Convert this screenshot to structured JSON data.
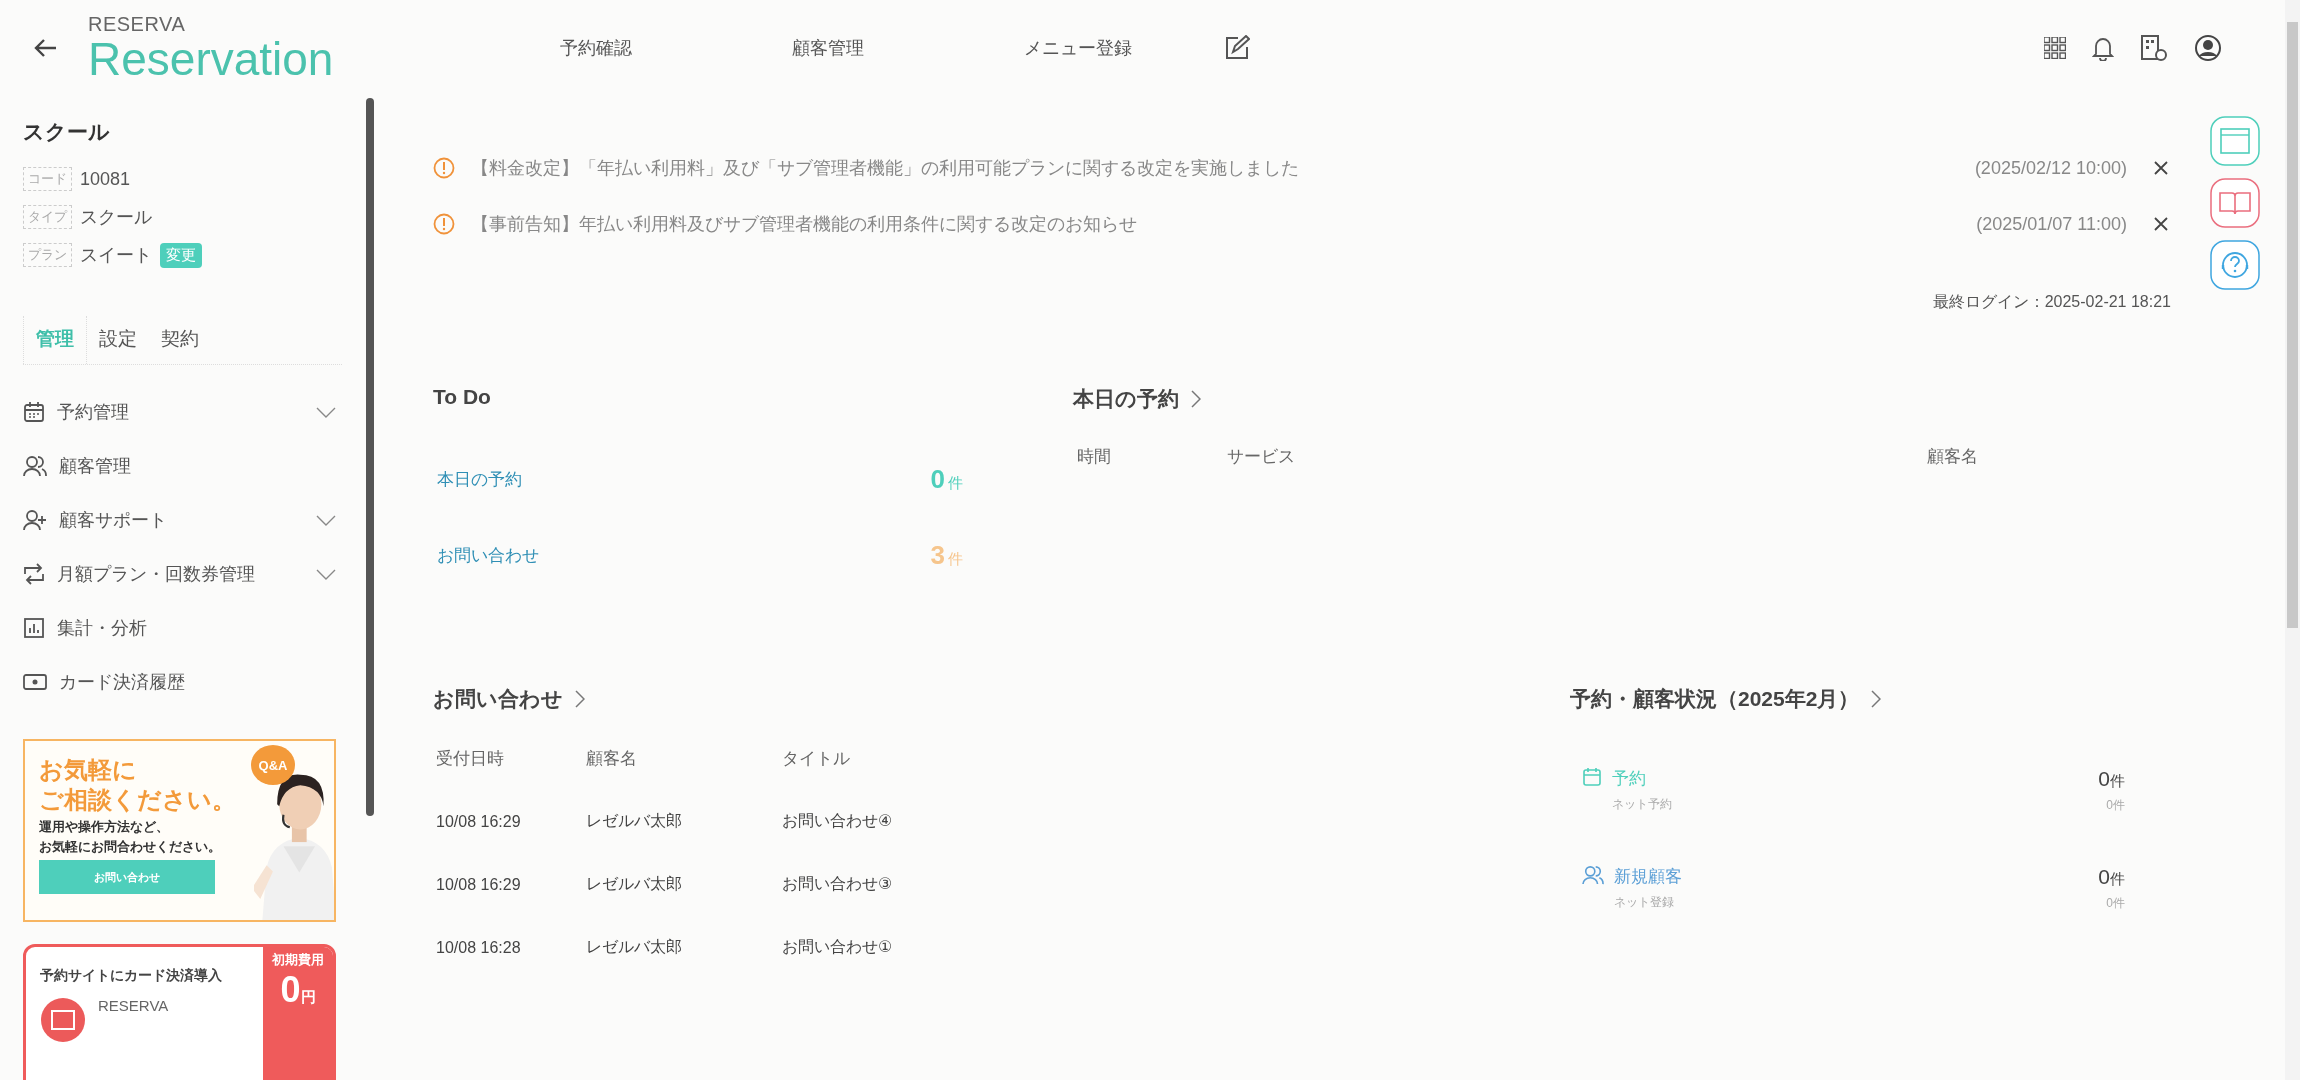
{
  "logo": {
    "small": "RESERVA",
    "large": "Reservation"
  },
  "nav": [
    "予約確認",
    "顧客管理",
    "メニュー登録"
  ],
  "account": {
    "name": "スクール",
    "fields": [
      {
        "label": "コード",
        "value": "10081"
      },
      {
        "label": "タイプ",
        "value": "スクール"
      },
      {
        "label": "プラン",
        "value": "スイート",
        "action": "変更"
      }
    ]
  },
  "sidebar_tabs": [
    {
      "label": "管理",
      "selected": true
    },
    {
      "label": "設定",
      "selected": false
    },
    {
      "label": "契約",
      "selected": false
    }
  ],
  "sidebar_menu": [
    {
      "label": "予約管理",
      "expandable": true
    },
    {
      "label": "顧客管理",
      "expandable": false
    },
    {
      "label": "顧客サポート",
      "expandable": true
    },
    {
      "label": "月額プラン・回数券管理",
      "expandable": true
    },
    {
      "label": "集計・分析",
      "expandable": false
    },
    {
      "label": "カード決済履歴",
      "expandable": false
    }
  ],
  "banners": [
    {
      "kind": "support",
      "title_lines": [
        "お気軽に",
        "ご相談ください。"
      ],
      "body_lines": [
        "運用や操作方法など、",
        "お気軽にお問合わせください。"
      ],
      "button": "お問い合わせ",
      "badge": "Q&A"
    },
    {
      "kind": "payment",
      "title": "予約サイトにカード決済導入",
      "side_label": "初期費用",
      "amount": "0",
      "unit": "円",
      "brand": "RESERVA"
    }
  ],
  "notices": [
    {
      "text": "【料金改定】「年払い利用料」及び「サブ管理者機能」の利用可能プランに関する改定を実施しました",
      "date": "(2025/02/12 10:00)"
    },
    {
      "text": "【事前告知】年払い利用料及びサブ管理者機能の利用条件に関する改定のお知らせ",
      "date": "(2025/01/07 11:00)"
    }
  ],
  "last_login": "最終ログイン：2025-02-21 18:21",
  "todo": {
    "title": "To Do",
    "items": [
      {
        "label": "本日の予約",
        "count": "0",
        "unit": "件",
        "color": "#4ecfbb"
      },
      {
        "label": "お問い合わせ",
        "count": "3",
        "unit": "件",
        "color": "#f6c58c"
      }
    ]
  },
  "today": {
    "title": "本日の予約",
    "columns": [
      "時間",
      "サービス",
      "顧客名"
    ]
  },
  "inquiries": {
    "title": "お問い合わせ",
    "columns": [
      "受付日時",
      "顧客名",
      "タイトル"
    ],
    "rows": [
      [
        "10/08 16:29",
        "レゼルバ太郎",
        "お問い合わせ④"
      ],
      [
        "10/08 16:29",
        "レゼルバ太郎",
        "お問い合わせ③"
      ],
      [
        "10/08 16:28",
        "レゼルバ太郎",
        "お問い合わせ①"
      ]
    ]
  },
  "status": {
    "title": "予約・顧客状況（2025年2月）",
    "items": [
      {
        "label": "予約",
        "sub": "ネット予約",
        "count": "0",
        "unit": "件",
        "sub_count": "0件",
        "color": "#4ecfbb"
      },
      {
        "label": "新規顧客",
        "sub": "ネット登録",
        "count": "0",
        "unit": "件",
        "sub_count": "0件",
        "color": "#5b9fd6"
      }
    ]
  }
}
